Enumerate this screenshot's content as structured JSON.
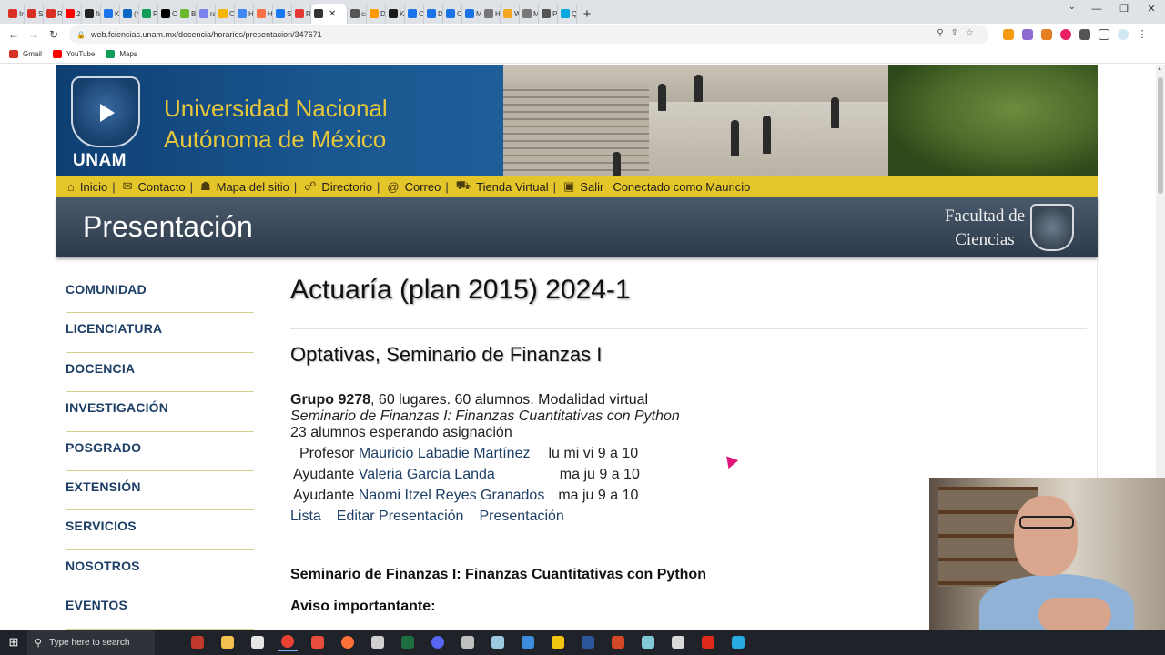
{
  "browser": {
    "tabs": [
      {
        "label": "Inb",
        "color": "#d93025"
      },
      {
        "label": "Sol",
        "color": "#d93025"
      },
      {
        "label": "Re",
        "color": "#d93025"
      },
      {
        "label": "20",
        "color": "#ff0000"
      },
      {
        "label": "fin",
        "color": "#222222"
      },
      {
        "label": "Kn",
        "color": "#1a73e8"
      },
      {
        "label": "(4)",
        "color": "#0a66c2"
      },
      {
        "label": "Pa",
        "color": "#0f9d58"
      },
      {
        "label": "Co",
        "color": "#000000"
      },
      {
        "label": "Bin",
        "color": "#6bb82f"
      },
      {
        "label": "ray",
        "color": "#7b83eb"
      },
      {
        "label": "Or",
        "color": "#f4b400"
      },
      {
        "label": "Ho",
        "color": "#4285f4"
      },
      {
        "label": "Ho",
        "color": "#ff7043"
      },
      {
        "label": "Sol",
        "color": "#1877f2"
      },
      {
        "label": "RA",
        "color": "#e53935"
      },
      {
        "label": "",
        "color": "#333333"
      },
      {
        "label": "cal",
        "color": "#555555"
      },
      {
        "label": "Du",
        "color": "#ff9900"
      },
      {
        "label": "Kir",
        "color": "#1a1a1a"
      },
      {
        "label": "Co",
        "color": "#1a73e8"
      },
      {
        "label": "De",
        "color": "#1a73e8"
      },
      {
        "label": "Co",
        "color": "#1a73e8"
      },
      {
        "label": "MC",
        "color": "#1a73e8"
      },
      {
        "label": "Ho",
        "color": "#777777"
      },
      {
        "label": "We",
        "color": "#f5a623"
      },
      {
        "label": "Ma",
        "color": "#777777"
      },
      {
        "label": "Pla",
        "color": "#555555"
      },
      {
        "label": "Qu",
        "color": "#00a7e1"
      }
    ],
    "active_tab_index": 16,
    "new_tab_label": "+",
    "url": "web.fciencias.unam.mx/docencia/horarios/presentacion/347671",
    "bookmarks": [
      {
        "label": "Gmail",
        "color": "#d93025"
      },
      {
        "label": "YouTube",
        "color": "#ff0000"
      },
      {
        "label": "Maps",
        "color": "#0f9d58"
      }
    ]
  },
  "site": {
    "header": {
      "university_line1": "Universidad Nacional",
      "university_line2": "Autónoma de México",
      "logo_text": "UNAM"
    },
    "menu": [
      {
        "icon": "home-icon",
        "label": "Inicio"
      },
      {
        "icon": "mail-icon",
        "label": "Contacto"
      },
      {
        "icon": "sitemap-icon",
        "label": "Mapa del sitio"
      },
      {
        "icon": "directory-icon",
        "label": "Directorio"
      },
      {
        "icon": "at-icon",
        "label": "Correo"
      },
      {
        "icon": "cart-icon",
        "label": "Tienda Virtual"
      },
      {
        "icon": "exit-icon",
        "label": "Salir"
      }
    ],
    "logged_in_text": "Conectado como Mauricio",
    "page_title": "Presentación",
    "faculty_line1": "Facultad de",
    "faculty_line2": "Ciencias",
    "sidebar": [
      "COMUNIDAD",
      "LICENCIATURA",
      "DOCENCIA",
      "INVESTIGACIÓN",
      "POSGRADO",
      "EXTENSIÓN",
      "SERVICIOS",
      "NOSOTROS",
      "EVENTOS"
    ]
  },
  "course": {
    "title": "Actuaría (plan 2015) 2024-1",
    "subject": "Optativas, Seminario de Finanzas I",
    "group_label": "Grupo 9278",
    "group_details": ", 60 lugares. 60 alumnos.  Modalidad virtual",
    "subtitle": "Seminario de Finanzas I: Finanzas Cuantitativas con Python",
    "waiting": "23 alumnos esperando asignación",
    "staff": [
      {
        "role": "Profesor",
        "name": "Mauricio Labadie Martínez",
        "schedule": "lu mi vi 9 a 10"
      },
      {
        "role": "Ayudante",
        "name": "Valeria García Landa",
        "schedule": "ma ju 9 a 10"
      },
      {
        "role": "Ayudante",
        "name": "Naomi Itzel Reyes Granados",
        "schedule": "ma ju 9 a 10"
      }
    ],
    "links": [
      "Lista",
      "Editar Presentación",
      "Presentación"
    ],
    "section_heading": "Seminario de Finanzas I: Finanzas Cuantitativas con Python",
    "notice_heading": "Aviso importantante:"
  },
  "taskbar": {
    "search_placeholder": "Type here to search",
    "apps": [
      {
        "name": "widgets-app",
        "color": "#c0392b"
      },
      {
        "name": "file-explorer",
        "color": "#f2c14e"
      },
      {
        "name": "store-app",
        "color": "#e6e6e6"
      },
      {
        "name": "chrome-app",
        "color": "#e94235"
      },
      {
        "name": "app-5",
        "color": "#e74c3c"
      },
      {
        "name": "firefox-app",
        "color": "#ff7139"
      },
      {
        "name": "app-7",
        "color": "#d0d0d0"
      },
      {
        "name": "excel-app",
        "color": "#1d6f42"
      },
      {
        "name": "discord-app",
        "color": "#5865f2"
      },
      {
        "name": "app-10",
        "color": "#bfbfbf"
      },
      {
        "name": "app-11",
        "color": "#9ecae1"
      },
      {
        "name": "app-12",
        "color": "#3c8dde"
      },
      {
        "name": "app-13",
        "color": "#f1c40f"
      },
      {
        "name": "word-app",
        "color": "#2b579a"
      },
      {
        "name": "powerpoint-app",
        "color": "#d24726"
      },
      {
        "name": "app-16",
        "color": "#7fc7d9"
      },
      {
        "name": "calculator-app",
        "color": "#d9d9d9"
      },
      {
        "name": "acrobat-app",
        "color": "#e0291b"
      },
      {
        "name": "app-19",
        "color": "#29a9e1"
      }
    ]
  }
}
